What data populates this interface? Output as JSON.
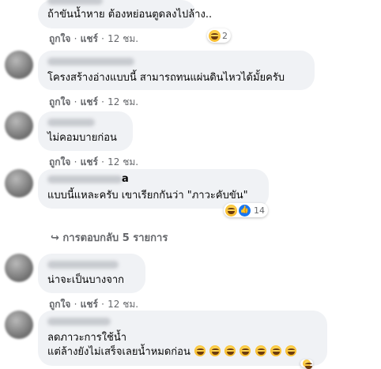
{
  "action_like": "ถูกใจ",
  "action_share": "แชร์",
  "sep": "·",
  "comments": [
    {
      "text1": "ถ้าขันน้ำหาย ต้องหย่อนตูดลงไปล้าง..",
      "time": "12 ชม.",
      "reaction_count": "2"
    },
    {
      "text1": "โครงสร้างอ่างแบบนี้ สามารถทนแผ่นดินไหวได้มั้ยครับ",
      "time": "12 ชม."
    },
    {
      "text1": "ไม่คอมบายก่อน",
      "time": "12 ชม."
    },
    {
      "name_fragment": "a",
      "text1": "แบบนี้แหละครับ เขาเรียกกันว่า \"ภาวะคับขัน\"",
      "reaction_count": "14"
    },
    {
      "text1": "น่าจะเป็นบางจาก",
      "time": "12 ชม."
    },
    {
      "text1": "ลดภาวะการใช้น้ำ",
      "text2": "แต่ล้างยังไม่เสร็จเลยน้ำหมดก่อน"
    }
  ],
  "replies_link": "↪ การตอบกลับ 5 รายการ"
}
